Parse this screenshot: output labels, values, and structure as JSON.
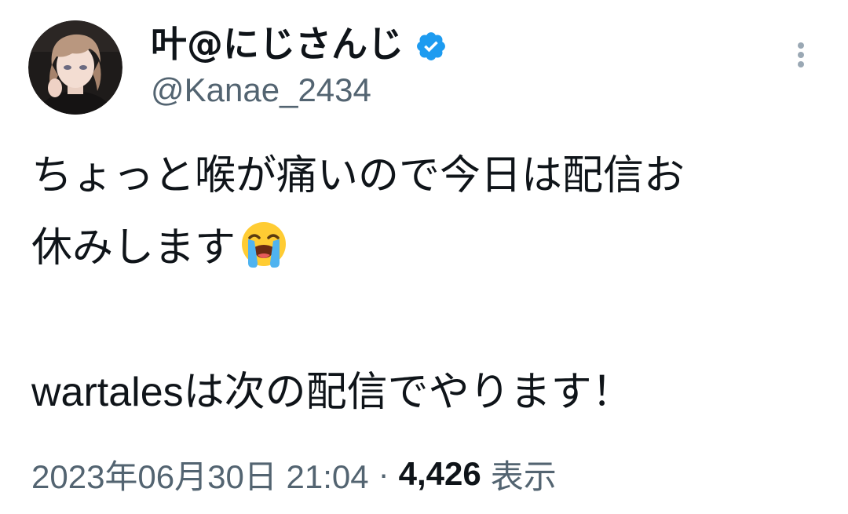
{
  "author": {
    "display_name": "叶@にじさんじ",
    "handle": "@Kanae_2434",
    "verified_icon": "verified-badge-icon",
    "avatar_icon": "avatar-image"
  },
  "menu": {
    "more_icon": "more-vertical-icon"
  },
  "tweet": {
    "lines": [
      "ちょっと喉が痛いので今日は配信お",
      "休みします",
      "",
      "wartalesは次の配信でやります！"
    ],
    "emoji_icon": "loudly-crying-face-emoji"
  },
  "meta": {
    "timestamp": "2023年06月30日 21:04",
    "separator": "·",
    "views_count": "4,426",
    "views_label": "表示"
  },
  "colors": {
    "text_primary": "#0f1419",
    "text_secondary": "#536471",
    "verified_blue": "#1d9bf0",
    "more_icon": "#9aa8b4"
  }
}
